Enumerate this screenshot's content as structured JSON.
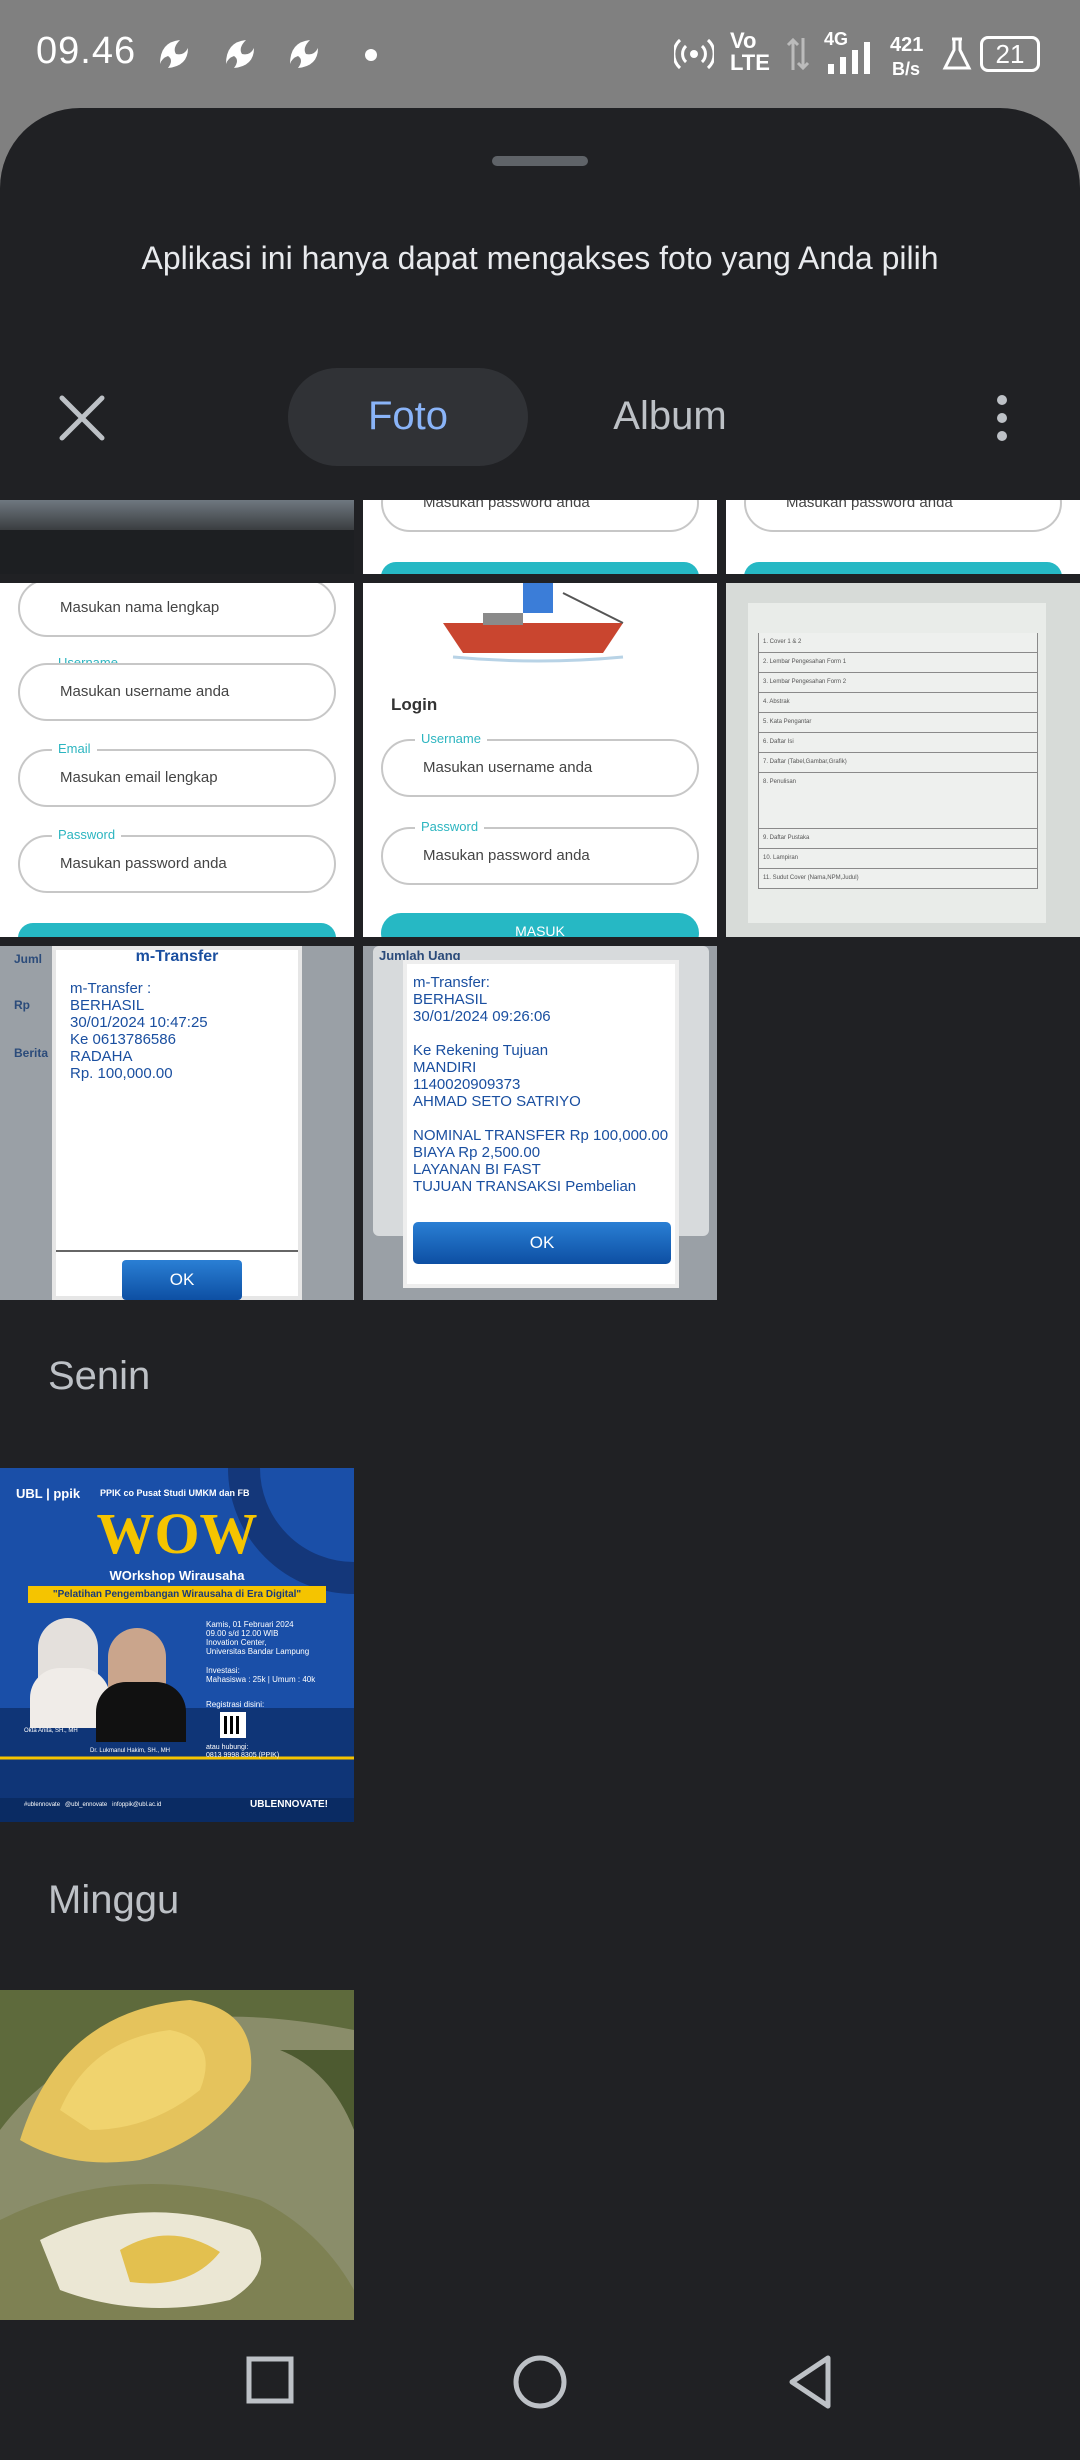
{
  "status_bar": {
    "time": "09.46",
    "net_type": "4G",
    "speed_value": "421",
    "speed_unit": "B/s",
    "volte_top": "Vo",
    "volte_bottom": "LTE",
    "battery": "21"
  },
  "sheet": {
    "notice": "Aplikasi ini hanya dapat mengakses foto yang Anda pilih",
    "tabs": [
      {
        "label": "Foto",
        "selected": true
      },
      {
        "label": "Album",
        "selected": false
      }
    ]
  },
  "photos": {
    "row1": {
      "p2_text": "Masukan password anda",
      "p3_text": "Masukan password anda"
    },
    "signup_form": {
      "name_placeholder": "Masukan nama lengkap",
      "username_label": "Username",
      "username_placeholder": "Masukan username anda",
      "email_label": "Email",
      "email_placeholder": "Masukan email lengkap",
      "password_label": "Password",
      "password_placeholder": "Masukan password anda"
    },
    "login_form": {
      "title": "Login",
      "username_label": "Username",
      "username_placeholder": "Masukan username anda",
      "password_label": "Password",
      "password_placeholder": "Masukan password anda",
      "button": "MASUK"
    },
    "document_rows": [
      "Cover 1 & 2",
      "Lembar Pengesahan Form 1",
      "Lembar Pengesahan Form 2",
      "Abstrak",
      "Kata Pengantar",
      "Daftar Isi",
      "Daftar (Tabel,Gambar,Grafik)",
      "Penulisan",
      "Daftar Pustaka",
      "Lampiran",
      "Sudut Cover (Nama,NPM,Judul)"
    ],
    "receipt1": {
      "title": "m-Transfer",
      "lines": [
        "m-Transfer :",
        "BERHASIL",
        "30/01/2024 10:47:25",
        "Ke 0613786586",
        "RADAHA",
        "Rp. 100,000.00"
      ],
      "ok": "OK",
      "side_labels": [
        "Juml",
        "Rp",
        "Berita"
      ]
    },
    "receipt2": {
      "lines": [
        "m-Transfer:",
        "BERHASIL",
        "30/01/2024 09:26:06",
        "",
        "Ke Rekening Tujuan",
        "MANDIRI",
        "1140020909373",
        "AHMAD SETO SATRIYO",
        "",
        "NOMINAL TRANSFER Rp 100,000.00",
        "BIAYA Rp 2,500.00",
        "LAYANAN BI FAST",
        "TUJUAN TRANSAKSI Pembelian"
      ],
      "ok": "OK",
      "side_label": "Jumlah Uang"
    },
    "poster": {
      "org": "PPIK co Pusat Studi UMKM dan FB",
      "title": "WOW",
      "subtitle": "WOrkshop Wirausaha",
      "tagline": "\"Pelatihan Pengembangan Wirausaha di Era Digital\"",
      "details": "Kamis, 01 Februari 2024\n09.00 s/d 12.00 WIB\nInovation Center,\nUniversitas Bandar Lampung",
      "investasi": "Investasi:\nMahasiswa : 25k | Umum : 40k",
      "registration": "Registrasi disini:",
      "contact": "atau hubungi:\n0813 9998 8305 (PPIK)",
      "speaker1": "Okta Anita, SH., MH",
      "speaker2": "Dr. Lukmanul Hakim, SH., MH",
      "footer": "#ublennovate   @ubl_ennovate   infoppik@ubl.ac.id",
      "brand": "UBLENNOVATE!"
    }
  },
  "sections": [
    {
      "label": "Senin"
    },
    {
      "label": "Minggu"
    }
  ]
}
